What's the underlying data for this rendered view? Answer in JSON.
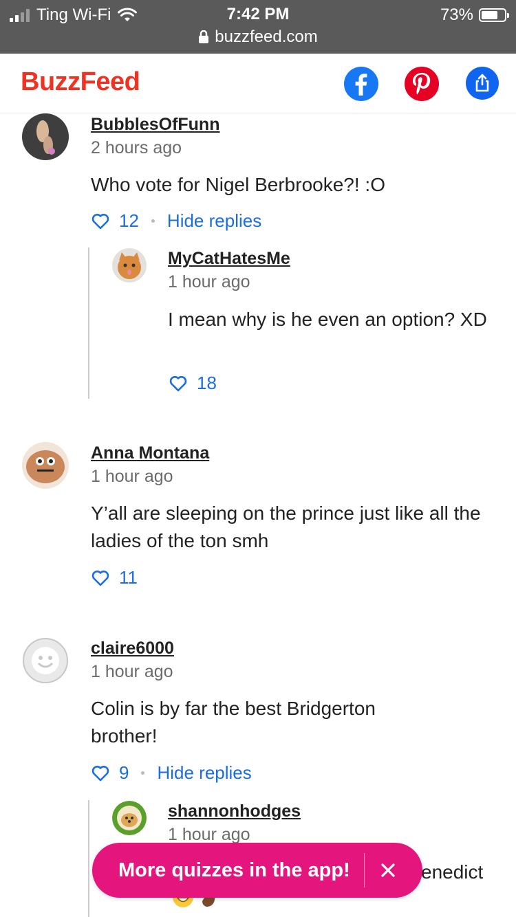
{
  "status": {
    "carrier": "Ting Wi-Fi",
    "time": "7:42 PM",
    "url": "buzzfeed.com",
    "battery": "73%",
    "battery_level": 0.73
  },
  "header": {
    "logo": "BuzzFeed",
    "share_icons": [
      "facebook-icon",
      "pinterest-icon",
      "share-icon"
    ]
  },
  "comments": [
    {
      "author": "BubblesOfFunn",
      "time": "2 hours ago",
      "text": "Who vote for Nigel Berbrooke?! :O",
      "likes": "12",
      "replies_label": "Hide replies",
      "replies": [
        {
          "author": "MyCatHatesMe",
          "time": "1 hour ago",
          "text": "I mean why is he even an option? XD",
          "likes": "18"
        }
      ]
    },
    {
      "author": "Anna Montana",
      "time": "1 hour ago",
      "text": "Y’all are sleeping on the prince just like all the ladies of the ton smh",
      "likes": "11"
    },
    {
      "author": "claire6000",
      "time": "1 hour ago",
      "text": "Colin is by far the best Bridgerton brother!",
      "likes": "9",
      "replies_label": "Hide replies",
      "replies": [
        {
          "author": "shannonhodges",
          "time": "1 hour ago",
          "text_visible_fragment": "enedict"
        }
      ]
    }
  ],
  "app_banner": {
    "label": "More quizzes in the app!",
    "close": "×"
  }
}
